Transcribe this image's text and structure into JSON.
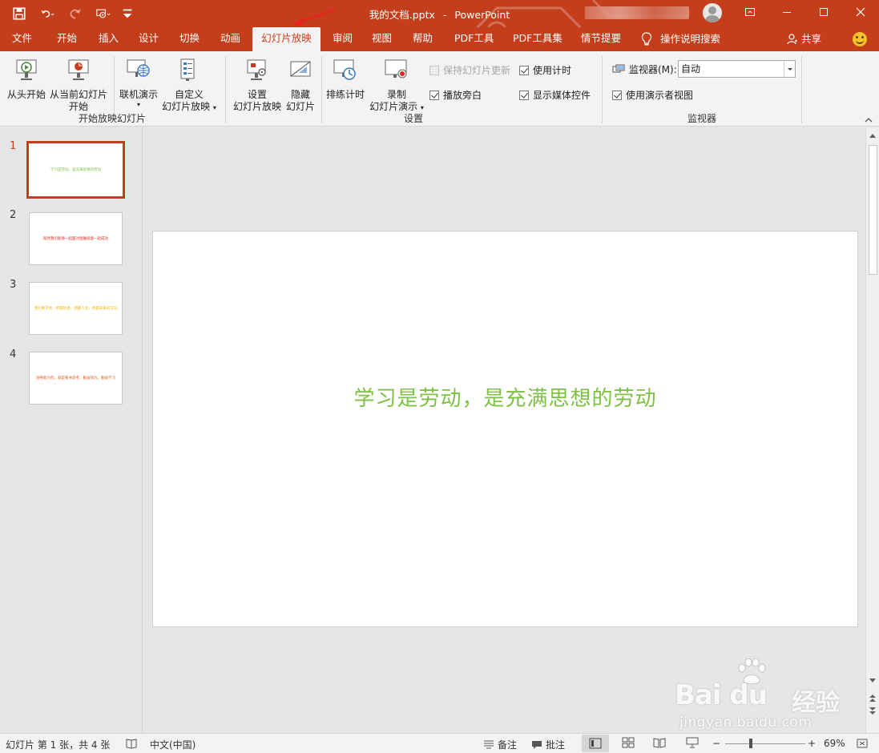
{
  "window": {
    "title_file": "我的文档.pptx",
    "title_sep": "-",
    "title_app": "PowerPoint",
    "accent": "#c43e1c"
  },
  "qat": {
    "icons": [
      "save-icon",
      "undo-icon",
      "redo-icon",
      "slideshow-from-start-icon",
      "customize-qat-icon"
    ]
  },
  "tabs": [
    {
      "label": "文件"
    },
    {
      "label": "开始"
    },
    {
      "label": "插入"
    },
    {
      "label": "设计"
    },
    {
      "label": "切换"
    },
    {
      "label": "动画"
    },
    {
      "label": "幻灯片放映",
      "active": true
    },
    {
      "label": "审阅"
    },
    {
      "label": "视图"
    },
    {
      "label": "帮助"
    },
    {
      "label": "PDF工具"
    },
    {
      "label": "PDF工具集"
    },
    {
      "label": "情节提要"
    }
  ],
  "tell_me": {
    "label": "操作说明搜索"
  },
  "share": {
    "label": "共享"
  },
  "ribbon": {
    "start_group": {
      "label": "开始放映幻灯片",
      "from_start": "从头开始",
      "from_current_1": "从当前幻灯片",
      "from_current_2": "开始",
      "online_1": "联机演示",
      "custom_1": "自定义",
      "custom_2": "幻灯片放映"
    },
    "setup_group": {
      "label": "设置",
      "setup_1": "设置",
      "setup_2": "幻灯片放映",
      "hide_1": "隐藏",
      "hide_2": "幻灯片",
      "rehearse": "排练计时",
      "record_1": "录制",
      "record_2": "幻灯片演示",
      "keep_updated": "保持幻灯片更新",
      "play_narrations": "播放旁白",
      "use_timings": "使用计时",
      "show_media_controls": "显示媒体控件"
    },
    "monitor_group": {
      "label": "监视器",
      "monitor_label": "监视器(M):",
      "monitor_value": "自动",
      "presenter_view": "使用演示者视图"
    }
  },
  "slides": [
    {
      "num": "1",
      "text": "学习是劳动，是充满思想的劳动",
      "color": "#7dc242"
    },
    {
      "num": "2",
      "text": "既然我们能够一起面对困难就能一起成功",
      "color": "#e8231e"
    },
    {
      "num": "3",
      "text": "我们要学会，把握机会，把握人生，把握未来的方向",
      "color": "#f2b700"
    },
    {
      "num": "4",
      "text": "培养能力的，就是看书思考，勤奋努力，勤奋学习",
      "color": "#e55a1b"
    }
  ],
  "current_slide": {
    "text": "学习是劳动，是充满思想的劳动",
    "color": "#7dc242"
  },
  "status": {
    "slide_info": "幻灯片 第 1 张，共 4 张",
    "language": "中文(中国)",
    "notes": "备注",
    "comments": "批注",
    "zoom_minus": "−",
    "zoom_plus": "+",
    "zoom": "69%"
  },
  "watermark": {
    "logo": "Bai du",
    "cn": "经验",
    "url": "jingyan.baidu.com"
  }
}
